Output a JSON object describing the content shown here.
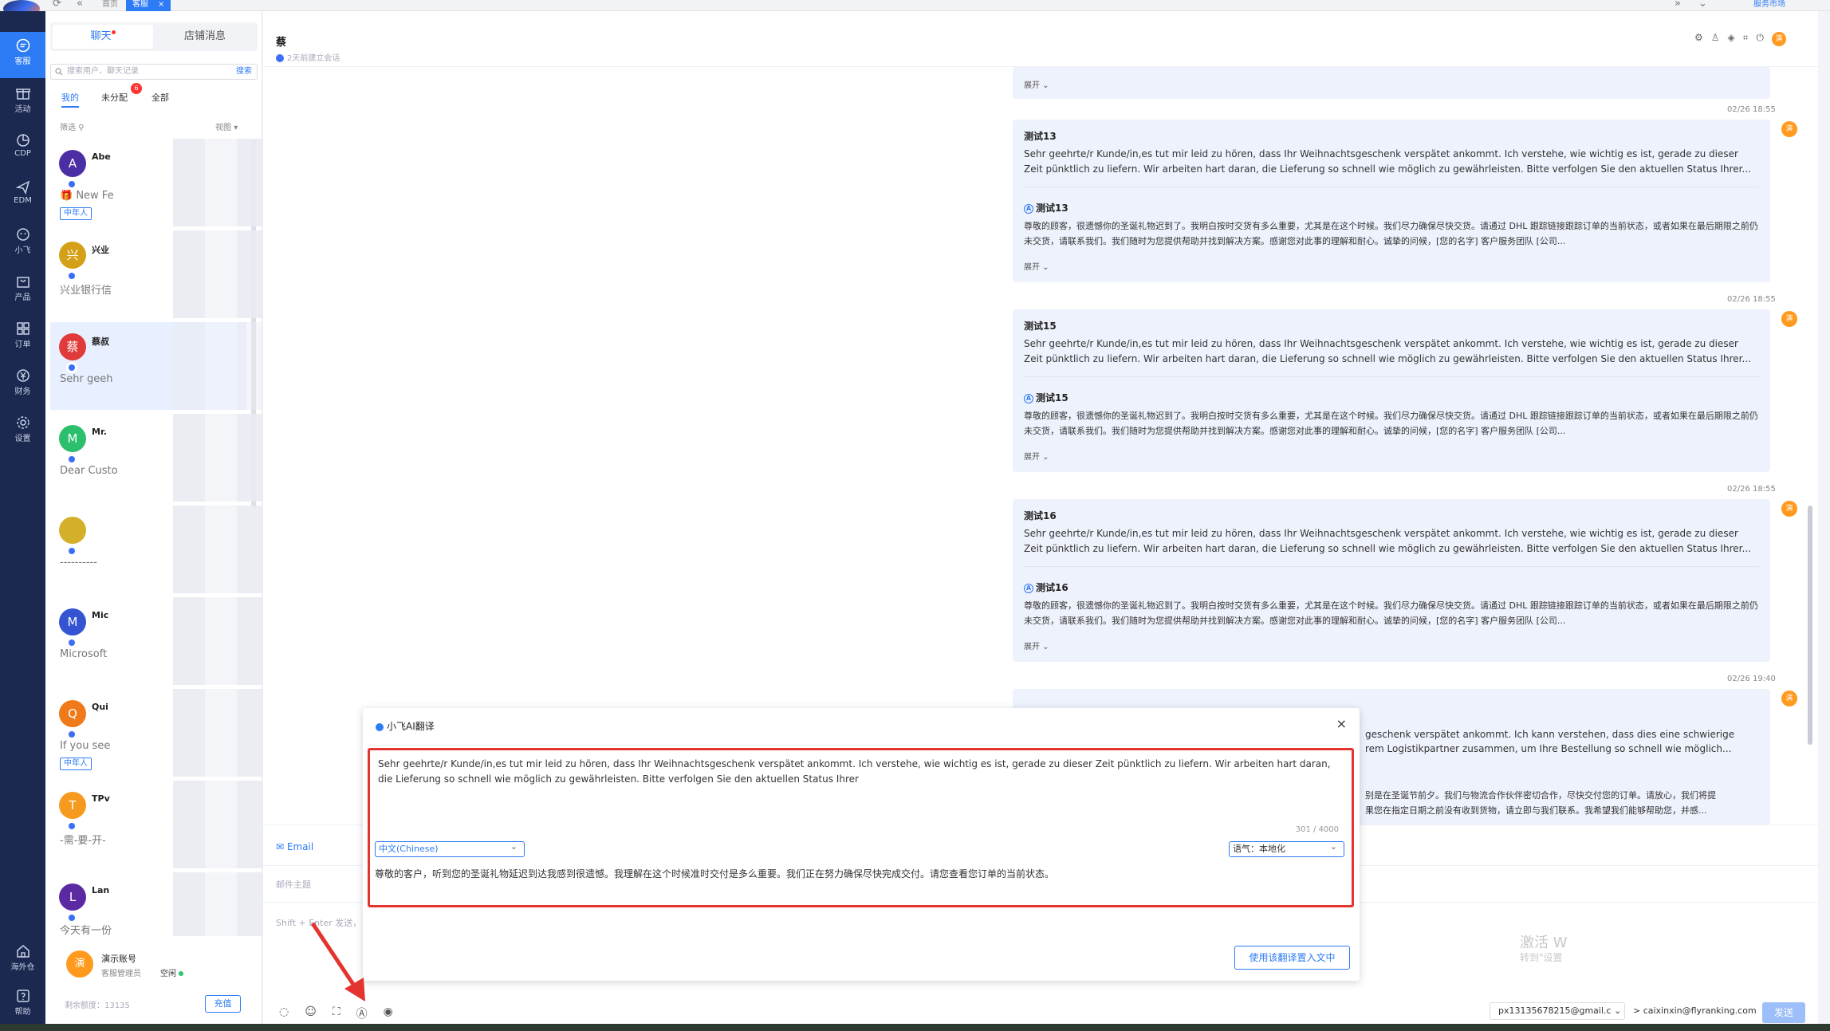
{
  "topbar": {
    "tabs": [
      {
        "label": "首页"
      },
      {
        "label": "客服",
        "close": "×"
      }
    ],
    "market": "服务市场"
  },
  "nav": {
    "items": [
      {
        "label": "客服",
        "icon": "chat-icon"
      },
      {
        "label": "活动",
        "icon": "gift-icon"
      },
      {
        "label": "CDP",
        "icon": "pie-chart-icon"
      },
      {
        "label": "EDM",
        "icon": "paper-plane-icon"
      },
      {
        "label": "小飞",
        "icon": "robot-icon"
      },
      {
        "label": "产品",
        "icon": "bag-icon"
      },
      {
        "label": "订单",
        "icon": "grid-icon"
      },
      {
        "label": "财务",
        "icon": "money-icon"
      },
      {
        "label": "设置",
        "icon": "gear-icon"
      }
    ],
    "bottom": [
      {
        "label": "海外仓",
        "icon": "warehouse-icon"
      },
      {
        "label": "帮助",
        "icon": "help-icon"
      }
    ]
  },
  "list": {
    "tabs": [
      "聊天",
      "店铺消息"
    ],
    "search_placeholder": "搜索用户、聊天记录",
    "search_button": "搜索",
    "filters": [
      "我的",
      "未分配",
      "全部"
    ],
    "unassigned_badge": "6",
    "sort_label": "筛选",
    "view_label": "视图",
    "conversations": [
      {
        "initial": "A",
        "name": "Abe",
        "preview": "🎁 New Fe",
        "tag": "中年人",
        "color": "#4b2ea3"
      },
      {
        "initial": "兴",
        "name": "兴业",
        "preview": "兴业银行信",
        "tag": "",
        "color": "#d4a017"
      },
      {
        "initial": "蔡",
        "name": "蔡叔",
        "preview": "Sehr geeh",
        "tag": "",
        "color": "#e03a3a"
      },
      {
        "initial": "M",
        "name": "Mr.",
        "preview": "Dear Custo",
        "tag": "",
        "color": "#2cbf6e"
      },
      {
        "initial": "",
        "name": "",
        "preview": "----------",
        "tag": "",
        "color": "#d4b02a"
      },
      {
        "initial": "M",
        "name": "Mic",
        "preview": "Microsoft",
        "tag": "",
        "color": "#3454d1"
      },
      {
        "initial": "Q",
        "name": "Qui",
        "preview": "If you see",
        "tag": "中年人",
        "color": "#f07a1a"
      },
      {
        "initial": "T",
        "name": "TPv",
        "preview": "-需-要-开-",
        "tag": "",
        "color": "#f59a1e"
      },
      {
        "initial": "L",
        "name": "Lan",
        "preview": "今天有一份",
        "tag": "",
        "color": "#5b2aa3"
      }
    ],
    "agent": {
      "initial": "演",
      "name": "演示账号",
      "role": "客服管理员",
      "status": "空闲"
    },
    "balance": "剩余额度：13135",
    "recharge": "充值"
  },
  "chat": {
    "title": "蔡",
    "subtitle": "2天前建立会话",
    "expand": "展开",
    "messages": [
      {
        "time": "02/26 18:55",
        "title": "测试13",
        "text": "Sehr geehrte/r Kunde/in,es tut mir leid zu hören, dass Ihr Weihnachtsgeschenk verspätet ankommt. Ich verstehe, wie wichtig es ist, gerade zu dieser Zeit pünktlich zu liefern. Wir arbeiten hart daran, die Lieferung so schnell wie möglich zu gewährleisten. Bitte verfolgen Sie den aktuellen Status Ihrer...",
        "tr_title": "测试13",
        "tr_text": "尊敬的顾客，很遗憾你的圣诞礼物迟到了。我明白按时交货有多么重要，尤其是在这个时候。我们尽力确保尽快交货。请通过 DHL 跟踪链接跟踪订单的当前状态，或者如果在最后期限之前仍未交货，请联系我们。我们随时为您提供帮助并找到解决方案。感谢您对此事的理解和耐心。诚挚的问候，[您的名字] 客户服务团队 [公司..."
      },
      {
        "time": "02/26 18:55",
        "title": "测试15",
        "text": "Sehr geehrte/r Kunde/in,es tut mir leid zu hören, dass Ihr Weihnachtsgeschenk verspätet ankommt. Ich verstehe, wie wichtig es ist, gerade zu dieser Zeit pünktlich zu liefern. Wir arbeiten hart daran, die Lieferung so schnell wie möglich zu gewährleisten. Bitte verfolgen Sie den aktuellen Status Ihrer...",
        "tr_title": "测试15",
        "tr_text": "尊敬的顾客，很遗憾你的圣诞礼物迟到了。我明白按时交货有多么重要，尤其是在这个时候。我们尽力确保尽快交货。请通过 DHL 跟踪链接跟踪订单的当前状态，或者如果在最后期限之前仍未交货，请联系我们。我们随时为您提供帮助并找到解决方案。感谢您对此事的理解和耐心。诚挚的问候，[您的名字] 客户服务团队 [公司..."
      },
      {
        "time": "02/26 18:55",
        "title": "测试16",
        "text": "Sehr geehrte/r Kunde/in,es tut mir leid zu hören, dass Ihr Weihnachtsgeschenk verspätet ankommt. Ich verstehe, wie wichtig es ist, gerade zu dieser Zeit pünktlich zu liefern. Wir arbeiten hart daran, die Lieferung so schnell wie möglich zu gewährleisten. Bitte verfolgen Sie den aktuellen Status Ihrer...",
        "tr_title": "测试16",
        "tr_text": "尊敬的顾客，很遗憾你的圣诞礼物迟到了。我明白按时交货有多么重要，尤其是在这个时候。我们尽力确保尽快交货。请通过 DHL 跟踪链接跟踪订单的当前状态，或者如果在最后期限之前仍未交货，请联系我们。我们随时为您提供帮助并找到解决方案。感谢您对此事的理解和耐心。诚挚的问候，[您的名字] 客户服务团队 [公司..."
      }
    ],
    "last_time": "02/26 19:40",
    "partial_text_1": "geschenk verspätet ankommt. Ich kann verstehen, dass dies eine schwierige",
    "partial_text_2": "rem Logistikpartner zusammen, um Ihre Bestellung so schnell wie möglich...",
    "partial_text_3": "别是在圣诞节前夕。我们与物流合作伙伴密切合作，尽快交付您的订单。请放心，我们将提",
    "partial_text_4": "果您在指定日期之前没有收到货物，请立即与我们联系。我希望我们能够帮助您，并感..."
  },
  "composer": {
    "channel": "Email",
    "subject_placeholder": "邮件主题",
    "body_placeholder": "Shift + Enter 发送，",
    "from": "px13135678215@gmail.c",
    "to": "> caixinxin@flyranking.com",
    "send": "发送",
    "watermark": "激活 W",
    "watermark2": "转到\"设置"
  },
  "dialog": {
    "title": "小飞AI翻译",
    "source": "Sehr geehrte/r Kunde/in,es tut mir leid zu hören, dass Ihr Weihnachtsgeschenk verspätet ankommt. Ich verstehe, wie wichtig es ist, gerade zu dieser Zeit pünktlich zu liefern. Wir arbeiten hart daran, die Lieferung so schnell wie möglich zu gewährleisten. Bitte verfolgen Sie den aktuellen Status Ihrer",
    "count": "301 / 4000",
    "language": "中文(Chinese)",
    "tone": "语气：本地化",
    "output": "尊敬的客户，听到您的圣诞礼物延迟到达我感到很遗憾。我理解在这个时候准时交付是多么重要。我们正在努力确保尽快完成交付。请您查看您订单的当前状态。",
    "apply": "使用该翻译置入文中"
  },
  "colors": {
    "accent": "#2d7bf5",
    "nav_bg": "#1b2850",
    "highlight": "#e3342f"
  }
}
